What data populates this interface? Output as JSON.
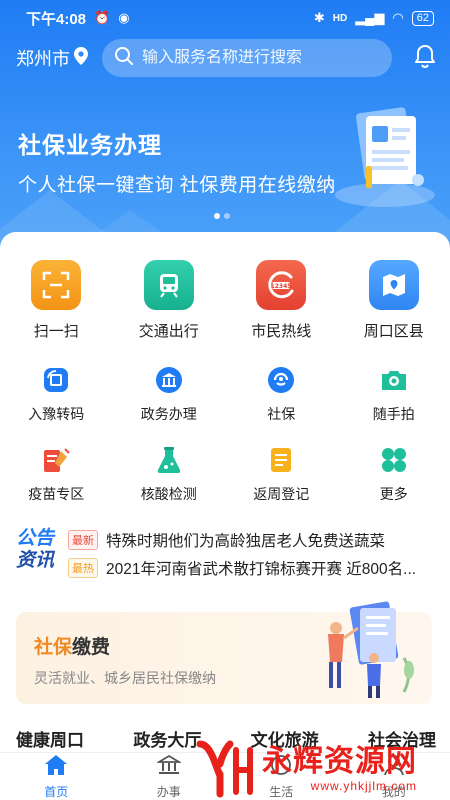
{
  "status_bar": {
    "time": "下午4:08",
    "network": "HD",
    "battery": "62"
  },
  "header": {
    "city": "郑州市",
    "search_placeholder": "输入服务名称进行搜索"
  },
  "banner": {
    "title": "社保业务办理",
    "subtitle": "个人社保一键查询 社保费用在线缴纳",
    "page_count": 2,
    "active_page": 1
  },
  "main_services": [
    {
      "label": "扫一扫",
      "icon": "scan-icon",
      "color": "#f7a21b"
    },
    {
      "label": "交通出行",
      "icon": "bus-icon",
      "color": "#1fbf9c"
    },
    {
      "label": "市民热线",
      "icon": "hotline-12345-icon",
      "color": "#ee4d3b"
    },
    {
      "label": "周口区县",
      "icon": "map-icon",
      "color": "#2f8ef5"
    }
  ],
  "sub_services": [
    {
      "label": "入豫转码",
      "icon": "code-transfer-icon",
      "color": "#1f7cf4"
    },
    {
      "label": "政务办理",
      "icon": "government-building-icon",
      "color": "#1f7cf4"
    },
    {
      "label": "社保",
      "icon": "social-security-icon",
      "color": "#1f7cf4"
    },
    {
      "label": "随手拍",
      "icon": "camera-icon",
      "color": "#1fbf9c"
    },
    {
      "label": "疫苗专区",
      "icon": "vaccine-icon",
      "color": "#ee4d3b"
    },
    {
      "label": "核酸检测",
      "icon": "test-flask-icon",
      "color": "#1fbf9c"
    },
    {
      "label": "返周登记",
      "icon": "registration-form-icon",
      "color": "#f7b21b"
    },
    {
      "label": "更多",
      "icon": "more-clover-icon",
      "color": "#1fbf9c"
    }
  ],
  "news": {
    "logo_line1": "公告",
    "logo_line2": "资讯",
    "items": [
      {
        "tag": "最新",
        "text": "特殊时期他们为高龄独居老人免费送蔬菜"
      },
      {
        "tag": "最热",
        "text": "2021年河南省武术散打锦标赛开赛 近800名..."
      }
    ]
  },
  "pay_card": {
    "title_highlight": "社保",
    "title_rest": "缴费",
    "subtitle": "灵活就业、城乡居民社保缴纳"
  },
  "sections": [
    "健康周口",
    "政务大厅",
    "文化旅游",
    "社会治理"
  ],
  "tabbar": [
    {
      "label": "首页",
      "icon": "home-icon",
      "active": true
    },
    {
      "label": "办事",
      "icon": "government-building-icon",
      "active": false
    },
    {
      "label": "生活",
      "icon": "life-icon",
      "active": false
    },
    {
      "label": "我的",
      "icon": "profile-icon",
      "active": false
    }
  ],
  "watermark": {
    "name": "永辉资源网",
    "url": "www.yhkjjlm.com"
  },
  "colors": {
    "primary": "#1f7cf4",
    "accent_orange": "#f08a24",
    "background": "#f5f6f8"
  }
}
